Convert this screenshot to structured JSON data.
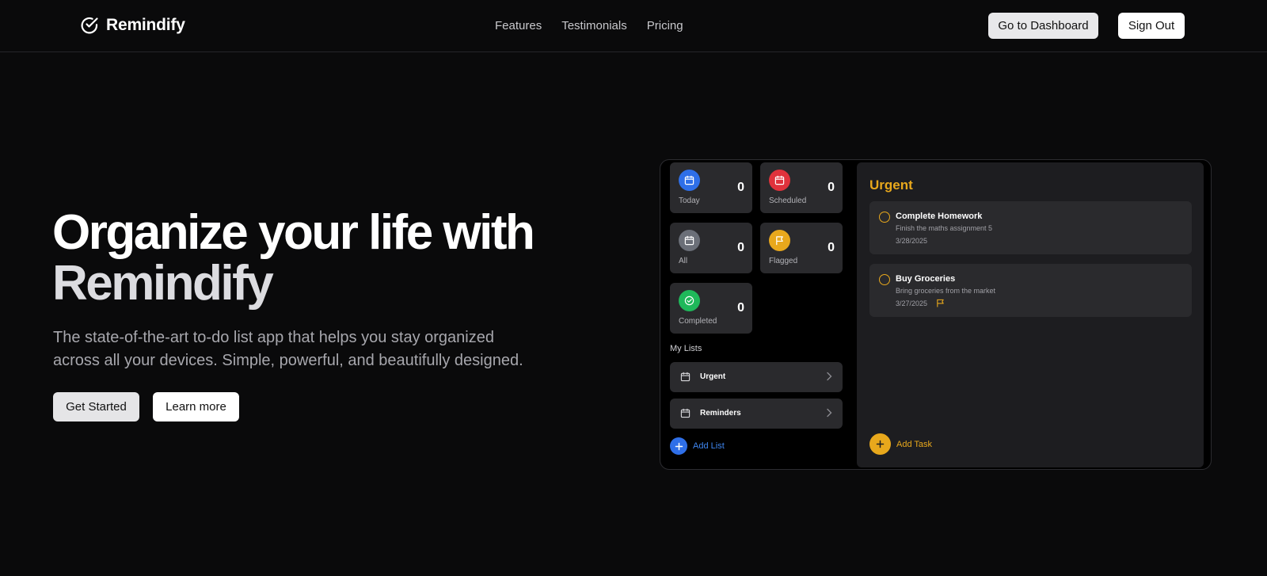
{
  "header": {
    "brand_name": "Remindify",
    "brand_icon": "check-circle-icon",
    "nav": [
      "Features",
      "Testimonials",
      "Pricing"
    ],
    "dashboard_label": "Go to Dashboard",
    "signout_label": "Sign Out"
  },
  "hero": {
    "title_line1": "Organize your life with",
    "title_line2": "Remindify",
    "subtitle_line1": "The state-of-the-art to-do list app that helps you stay organized",
    "subtitle_line2": "across all your devices. Simple, powerful, and beautifully designed.",
    "get_started_label": "Get Started",
    "learn_more_label": "Learn more"
  },
  "app": {
    "tiles": [
      {
        "label": "Today",
        "count": "0",
        "color": "#2f6fe8",
        "icon": "calendar-icon"
      },
      {
        "label": "Scheduled",
        "count": "0",
        "color": "#e0323c",
        "icon": "calendar-icon"
      },
      {
        "label": "All",
        "count": "0",
        "color": "#6b6f78",
        "icon": "calendar-icon"
      },
      {
        "label": "Flagged",
        "count": "0",
        "color": "#e8a81c",
        "icon": "flag-icon"
      },
      {
        "label": "Completed",
        "count": "0",
        "color": "#1fb85a",
        "icon": "check-circle-icon"
      }
    ],
    "my_lists_title": "My Lists",
    "lists": [
      {
        "name": "Urgent",
        "icon": "calendar-icon"
      },
      {
        "name": "Reminders",
        "icon": "calendar-icon"
      }
    ],
    "add_list_label": "Add List",
    "detail": {
      "title": "Urgent",
      "title_color": "#e8a81c",
      "tasks": [
        {
          "title": "Complete Homework",
          "description": "Finish the maths assignment 5",
          "date": "3/28/2025",
          "flagged": false
        },
        {
          "title": "Buy Groceries",
          "description": "Bring groceries from the market",
          "date": "3/27/2025",
          "flagged": true
        }
      ],
      "add_task_label": "Add Task"
    }
  }
}
